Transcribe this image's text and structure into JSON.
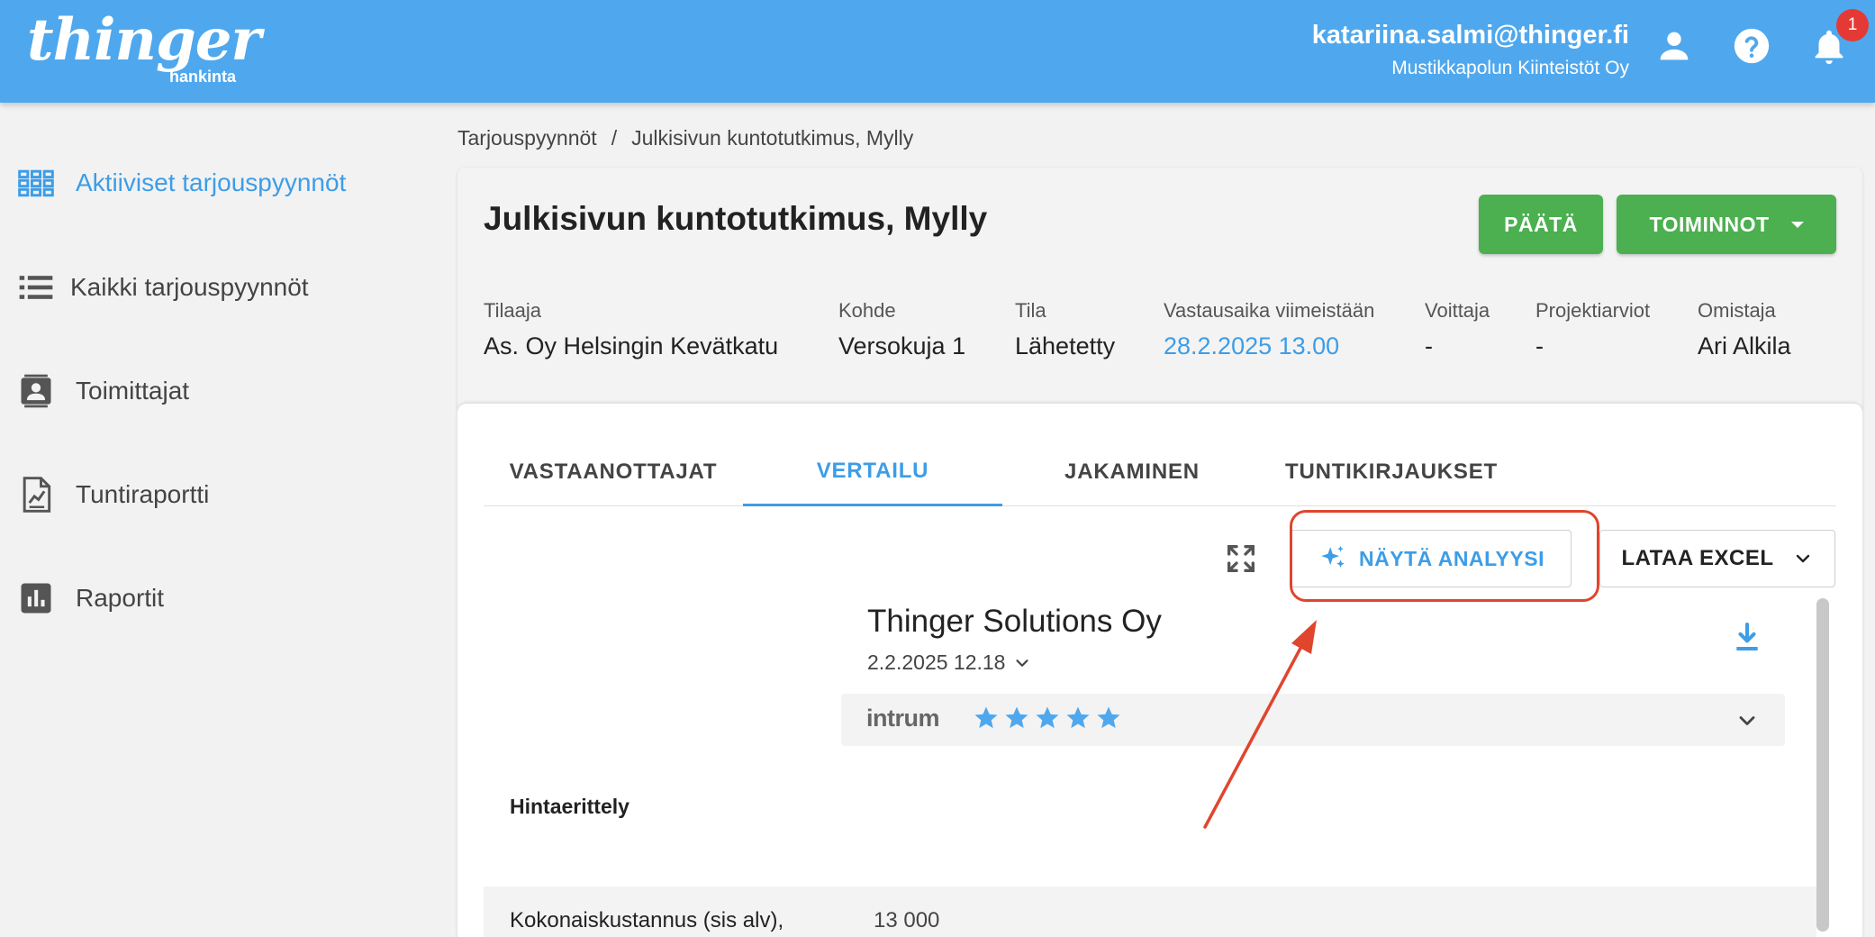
{
  "app": {
    "logo_main": "thinger",
    "logo_sub": "hankinta",
    "user_email": "katariina.salmi@thinger.fi",
    "user_company": "Mustikkapolun Kiinteistöt Oy",
    "notification_count": "1",
    "accent_color": "#4fa8ee"
  },
  "sidebar": {
    "items": [
      {
        "label": "Aktiiviset tarjouspyynnöt",
        "icon": "grid-icon",
        "active": true
      },
      {
        "label": "Kaikki tarjouspyynnöt",
        "icon": "list-icon"
      },
      {
        "label": "Toimittajat",
        "icon": "contact-card-icon"
      },
      {
        "label": "Tuntiraportti",
        "icon": "report-chart-icon"
      },
      {
        "label": "Raportit",
        "icon": "bar-chart-icon"
      }
    ]
  },
  "breadcrumb": {
    "root": "Tarjouspyynnöt",
    "separator": "/",
    "current": "Julkisivun kuntotutkimus, Mylly"
  },
  "request": {
    "title": "Julkisivun kuntotutkimus, Mylly",
    "decide_label": "PÄÄTÄ",
    "actions_label": "TOIMINNOT",
    "meta": [
      {
        "label": "Tilaaja",
        "value": "As. Oy Helsingin Kevätkatu"
      },
      {
        "label": "Kohde",
        "value": "Versokuja 1"
      },
      {
        "label": "Tila",
        "value": "Lähetetty"
      },
      {
        "label": "Vastausaika viimeistään",
        "value": "28.2.2025 13.00"
      },
      {
        "label": "Voittaja",
        "value": "-"
      },
      {
        "label": "Projektiarviot",
        "value": "-"
      },
      {
        "label": "Omistaja",
        "value": "Ari Alkila"
      }
    ]
  },
  "tabs": [
    {
      "label": "VASTAANOTTAJAT"
    },
    {
      "label": "VERTAILU",
      "active": true
    },
    {
      "label": "JAKAMINEN"
    },
    {
      "label": "TUNTIKIRJAUKSET"
    }
  ],
  "toolbar": {
    "analysis_label": "NÄYTÄ ANALYYSI",
    "excel_label": "LATAA EXCEL"
  },
  "offer": {
    "supplier": "Thinger Solutions Oy",
    "date": "2.2.2025 12.18",
    "rating_provider": "intrum",
    "rating_stars": 5
  },
  "comparison": {
    "section_label": "Hintaerittely",
    "rows": [
      {
        "label": "Kokonaiskustannus (sis alv),",
        "value": "13 000"
      }
    ]
  }
}
